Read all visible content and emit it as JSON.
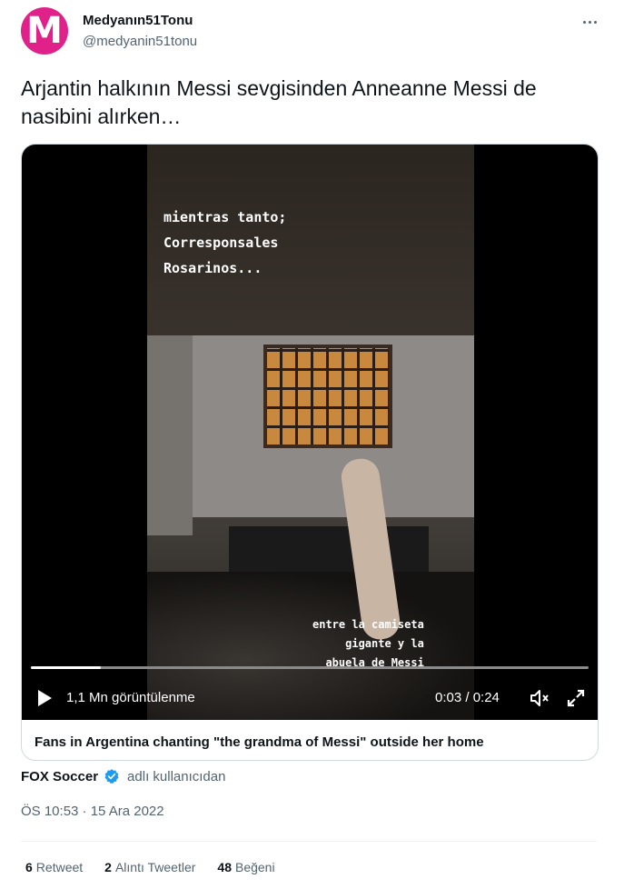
{
  "author": {
    "display_name": "Medyanın51Tonu",
    "handle": "@medyanin51tonu",
    "avatar_letter": "M",
    "avatar_color": "#e0218a"
  },
  "tweet": {
    "text": "Arjantin halkının Messi sevgisinden Anneanne Messi de nasibini alırken…"
  },
  "video": {
    "overlay_top_lines": [
      "mientras tanto;",
      "Corresponsales",
      "Rosarinos..."
    ],
    "overlay_bottom_lines": [
      "entre la camiseta",
      "gigante y la",
      "abuela de Messi"
    ],
    "views": "1,1 Mn görüntülenme",
    "time": "0:03 / 0:24",
    "progress": 0.125
  },
  "card": {
    "title": "Fans in Argentina chanting \"the grandma of Messi\" outside her home"
  },
  "source": {
    "name": "FOX Soccer",
    "verified_color": "#1d9bf0",
    "by_label": "adlı kullanıcıdan"
  },
  "meta": {
    "timestamp": "ÖS 10:53 · 15 Ara 2022"
  },
  "stats": {
    "retweets_count": "6",
    "retweets_label": "Retweet",
    "quotes_count": "2",
    "quotes_label": "Alıntı Tweetler",
    "likes_count": "48",
    "likes_label": "Beğeni"
  },
  "icons": [
    "more-icon",
    "play-icon",
    "volume-icon",
    "fullscreen-icon",
    "verified-badge-icon"
  ]
}
